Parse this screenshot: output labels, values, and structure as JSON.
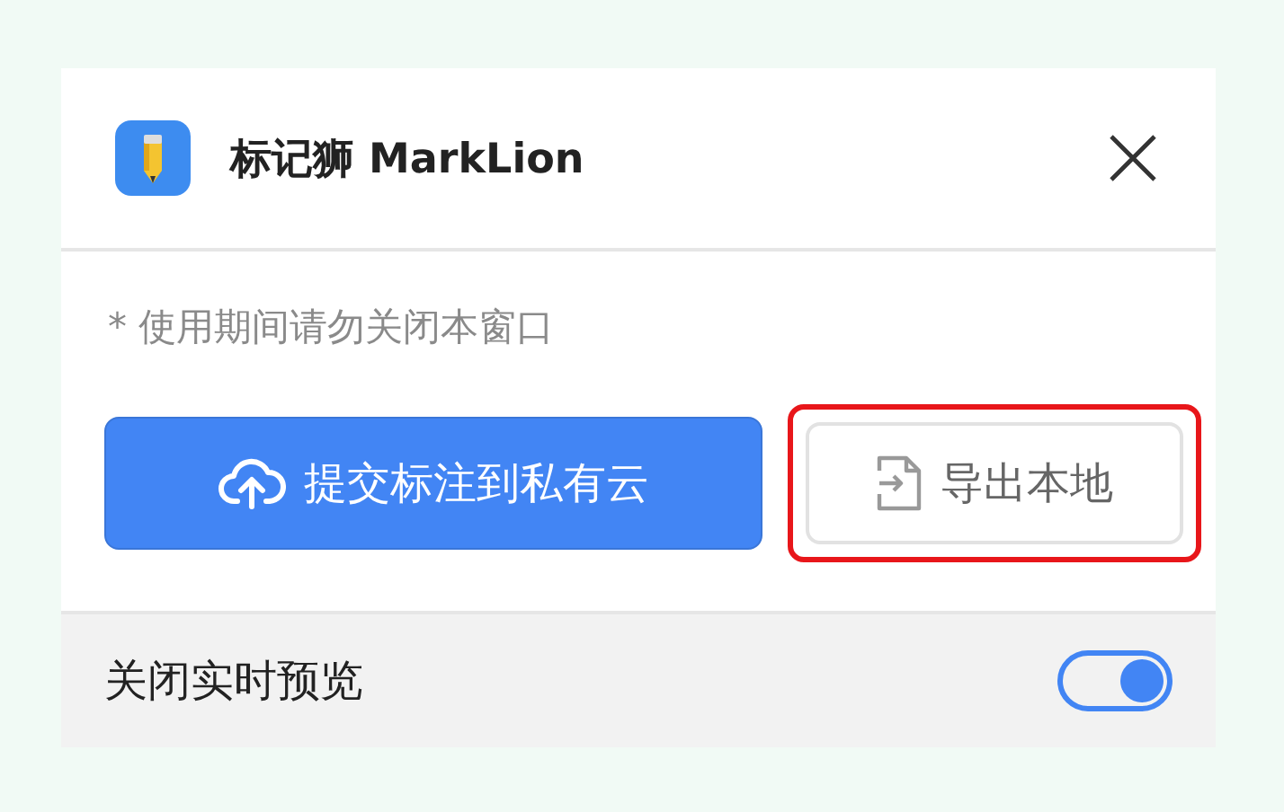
{
  "header": {
    "title": "标记狮 MarkLion"
  },
  "notice": "* 使用期间请勿关闭本窗口",
  "buttons": [
    {
      "label": "提交标注到私有云",
      "kind": "primary",
      "highlighted": false
    },
    {
      "label": "导出本地",
      "kind": "secondary",
      "highlighted": true
    }
  ],
  "preview": {
    "label": "关闭实时预览",
    "on": true
  }
}
